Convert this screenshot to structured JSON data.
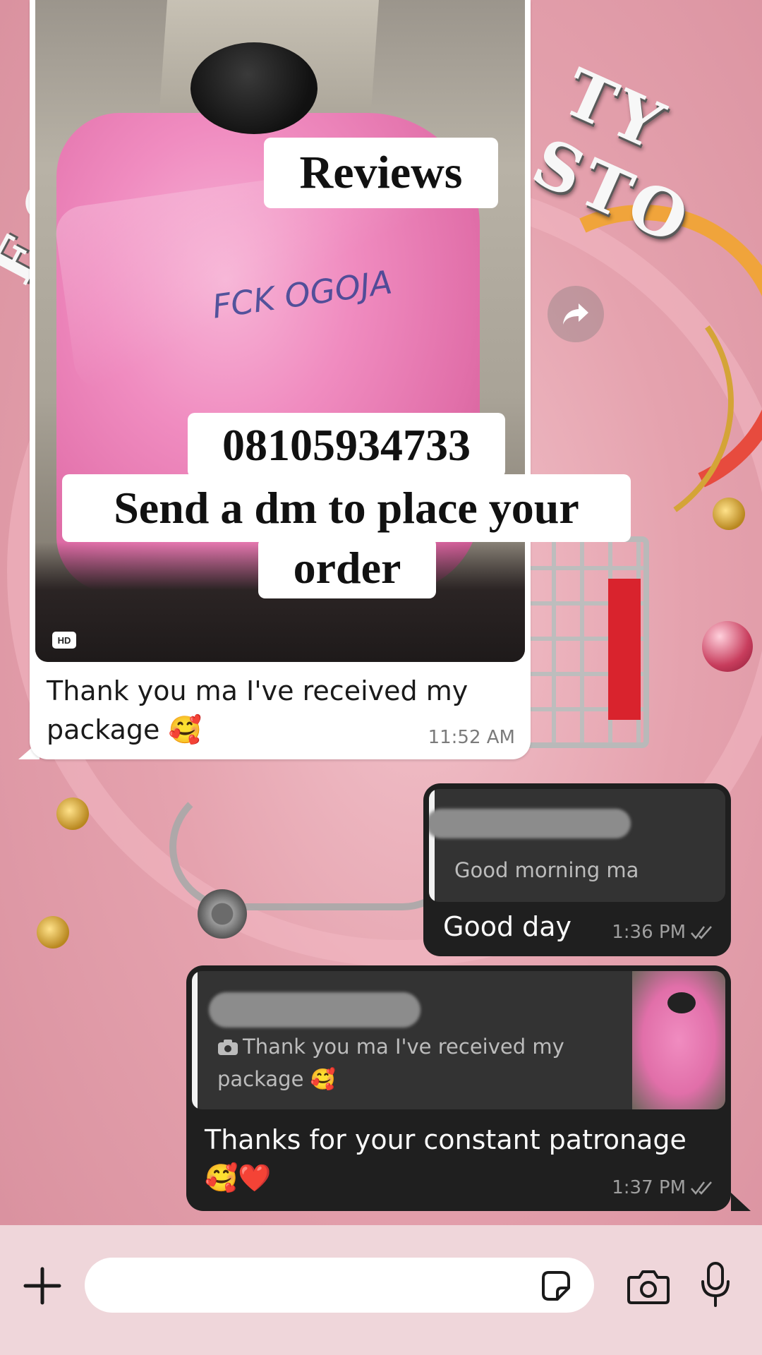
{
  "overlay": {
    "title": "Reviews",
    "phone": "08105934733",
    "cta_line1": "Send a dm to place your",
    "cta_line2": "order"
  },
  "incoming_message": {
    "badge": "HD",
    "photo_scribble": "FCK OGOJA",
    "caption": "Thank you ma I've received my package 🥰",
    "time": "11:52 AM"
  },
  "outgoing_messages": [
    {
      "quoted_text": "Good morning ma",
      "text": "Good day",
      "time": "1:36 PM",
      "status_icon": "double-check-icon"
    },
    {
      "quoted_text": "Thank you ma I've received my package 🥰",
      "quoted_icon": "camera-icon",
      "text": "Thanks for your constant patronage 🥰❤️",
      "time": "1:37 PM",
      "status_icon": "double-check-icon"
    }
  ],
  "wallpaper": {
    "letters_right": "TY STO",
    "letters_left": "E C"
  },
  "input_bar": {
    "placeholder": "",
    "value": ""
  },
  "colors": {
    "wallpaper_pink": "#e7a6b1",
    "incoming_bubble": "#ffffff",
    "outgoing_bubble": "#1f1f1f",
    "quote_bg": "#333333",
    "input_bar_bg": "#efd6da"
  }
}
